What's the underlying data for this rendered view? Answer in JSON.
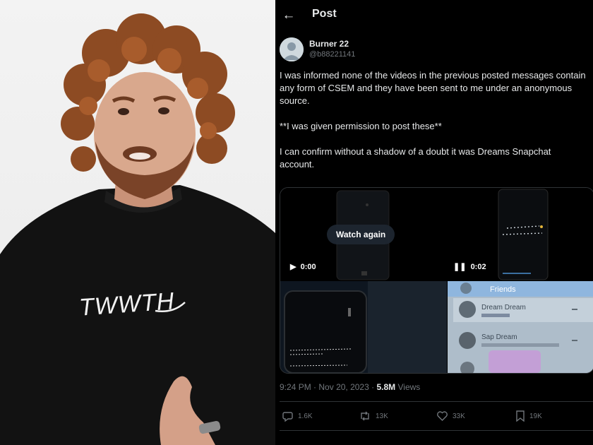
{
  "photo": {
    "shirt_text": "TWWTH",
    "colors": {
      "background": "#eeeeee",
      "hair": "#8a4a22",
      "skin": "#d7a58a",
      "shirt": "#111111"
    }
  },
  "post": {
    "header_title": "Post",
    "author": {
      "name": "Burner 22",
      "handle": "@b88221141"
    },
    "body": [
      "I was informed none of the videos in the previous posted messages contain any form of CSEM and they have been sent to me under an anonymous source.",
      "**I was given permission to post these**",
      "I can confirm without a shadow of a doubt it was Dreams Snapchat account."
    ],
    "media": {
      "watch_again_label": "Watch again",
      "video1_time": "0:00",
      "video2_time": "0:02",
      "snapchat_rows": [
        "Dream Dream",
        "Sap Dream"
      ],
      "friends_label": "Friends"
    },
    "meta": {
      "time": "9:24 PM",
      "date": "Nov 20, 2023",
      "views_count": "5.8M",
      "views_label": "Views",
      "separator": "·"
    },
    "stats": {
      "replies": "1.6K",
      "reposts": "13K",
      "likes": "33K",
      "bookmarks": "19K"
    },
    "colors": {
      "background": "#000000",
      "text": "#e7e9ea",
      "muted": "#71767b",
      "border": "#2f3336"
    }
  }
}
